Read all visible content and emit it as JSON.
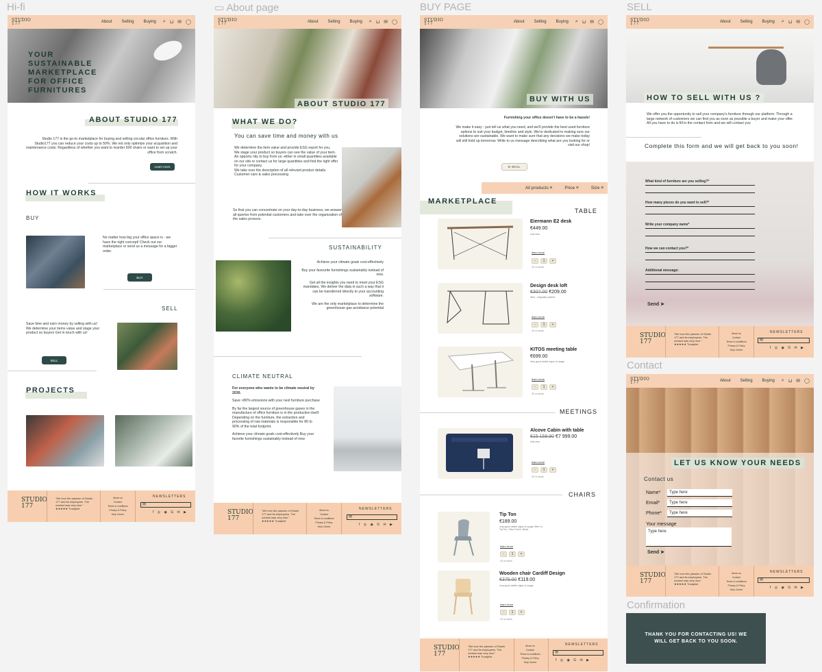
{
  "frames": {
    "hifi": "Hi-fi",
    "about": "About page",
    "buy": "BUY PAGE",
    "sell": "SELL",
    "contact": "Contact",
    "confirmation": "Confirmation"
  },
  "header": {
    "logo_line1": "STUDIO",
    "logo_line2": "177",
    "nav": [
      "About",
      "Selling",
      "Buying"
    ],
    "icons": [
      "search-icon",
      "cart-icon",
      "mail-icon",
      "user-icon"
    ]
  },
  "hifi": {
    "hero_title": "YOUR SUSTAINABLE MARKETPLACE FOR OFFICE FURNITURES",
    "about_title": "ABOUT STUDIO 177",
    "about_text": "Studio 177 is the go-to marketplace for buying and selling circular office furniture. With Studio177 you can reduce your costs up to 50%. We not only optimize your acquisition and maintenance costs: Regardless of whether you want to rearder 500 chairs or want to set up your office from scratch.",
    "learn_more": "Learn more",
    "how_title": "HOW IT WORKS",
    "buy_label": "BUY",
    "buy_text": "No matter how big your office space is - we have the right concept! Check out our marketplace or send us a message for a bigger order.",
    "buy_btn": "BUY",
    "sell_label": "SELL",
    "sell_text": "Save time and earn money by selling with us! We determine your items value and stage your product so buyers Get in touch with us!",
    "sell_btn": "SELL",
    "projects_title": "PROJECTS"
  },
  "about": {
    "hero_title": "ABOUT STUDIO 177",
    "what_title": "WHAT WE DO?",
    "what_sub": "You can save time and money with us",
    "bullets": [
      "We determine the item value and provide ESG report for you.",
      "We stage your product so buyers can see the value of your item.",
      "An opportu      nity to buy from us: either in small quantities available on our site or contact us for large quantities and find the right offer for your company.",
      "We take over the description of all relevant product details.",
      "Customer care & sales processing"
    ],
    "what_text": "So that you can concentrate on your day-to-day business, we answer all queries from potential customers and take over the organization of the sales process.",
    "sus_title": "SUSTAINABILITY",
    "sus_lines": [
      "Achieve your climate goals cost-effectively",
      "Buy your favourite furnishings sustainably instead of new.",
      "Get all the insights you need to meet your ESG mandates. We deliver the data in such a way that it can be transferred directly to your accounting software.",
      "We are the only marketplace to determine the greenhouse gas avoidance potential"
    ],
    "climate_title": "CLIMATE NEUTRAL",
    "climate_lines": [
      "For everyone who wants to be climate neutral by 2030.",
      "Save >80% emissions with your next furniture purchase",
      "By far the largest source of greenhouse gases in the manufacture of office furniture is in the production itself. Depending on the furniture, the extraction and processing of raw materials is responsible for 80 to 90% of the total footprint.",
      "Achieve your climate goals cost-effectively Buy your favorite furnishings sustainably instead of new"
    ]
  },
  "buy": {
    "hero_title": "BUY WITH US",
    "lead": "Furnishing your office doesn't have to be a hassle!",
    "text": "We make it easy - just tell us what you need, and we'll provide the best used furniture options to suit your budget, timeline and style. We're dedicated to making sure our solutions are sustainable. We want to make sure that any decisions we make today will still hold up tomorrow. Write to us message describing what are you looking for or visit our shop!",
    "email_btn": "E-MAIL",
    "filters": [
      "All products",
      "Price",
      "Size"
    ],
    "market_title": "MARKETPLACE",
    "cat_table": "TABLE",
    "cat_meetings": "MEETINGS",
    "cat_chairs": "CHAIRS",
    "learn_more": "learn more",
    "stock": "40 on stock",
    "products": [
      {
        "name": "Eiermann E2 desk",
        "old": "",
        "price": "€449.00",
        "sub": "Like new"
      },
      {
        "name": "Design desk loft",
        "old": "€307.00",
        "price": "€209.00",
        "sub": "New - originally packed"
      },
      {
        "name": "KITOS meeting table",
        "old": "",
        "price": "€699.00",
        "sub": "Very good visible signs of usage"
      },
      {
        "name": "Alcove Cabin with table",
        "old": "€15 158.90",
        "price": "€7 999.00",
        "sub": "Like new"
      },
      {
        "name": "Tip Ton",
        "old": "",
        "price": "€189.00",
        "sub": "very good visible signs of usage Offer 1x Tip Ton, Olive Green, Black"
      },
      {
        "name": "Wooden chair Cardiff Design",
        "old": "€375.00",
        "price": "€119.00",
        "sub": "very good visible signs of usage"
      }
    ]
  },
  "sell": {
    "hero_title": "HOW TO SELL WITH US ?",
    "text": "We offer you the opportunity to sell your company's furniture through our platform. Through a large network of customers we can find you as soon as possible a buyer and make your offer. All you have to do is fill in the contact form and we will contact you",
    "form_title": "Complete this form and we will get back to you soon!",
    "questions": [
      "What kind of furniture are you selling?*",
      "How many pieces do you want to sell?*",
      "Write your company name*",
      "How we can contact you?*",
      "Additional message:"
    ],
    "send": "Send"
  },
  "contact": {
    "hero_title": "LET US KNOW YOUR NEEDS",
    "form_title": "Contact us",
    "name_label": "Name*",
    "email_label": "Email*",
    "phone_label": "Phone*",
    "message_label": "Your message",
    "placeholder": "Type here",
    "send": "Send"
  },
  "confirmation": {
    "text": "THANK YOU FOR CONTACTING US! WE WILL GET BACK TO YOU SOON."
  },
  "footer": {
    "quote": "\"We love the passion of Studio 177 and its employees. The contact was very nice.\"",
    "stars": "★★★★★",
    "trustpilot": "Trustpilot",
    "links": [
      "About us",
      "Contact",
      "Terms & conditions",
      "Privacy & Policy",
      "Help Centre"
    ],
    "newsletter": "NEWSLETTERS",
    "social": "f ◎ ◉ G ✉ ▶"
  },
  "colors": {
    "peach": "#f7d1b5",
    "dark_teal": "#2c4a48",
    "sage": "#e3e8dd",
    "confirm_bg": "#3e4f50"
  }
}
